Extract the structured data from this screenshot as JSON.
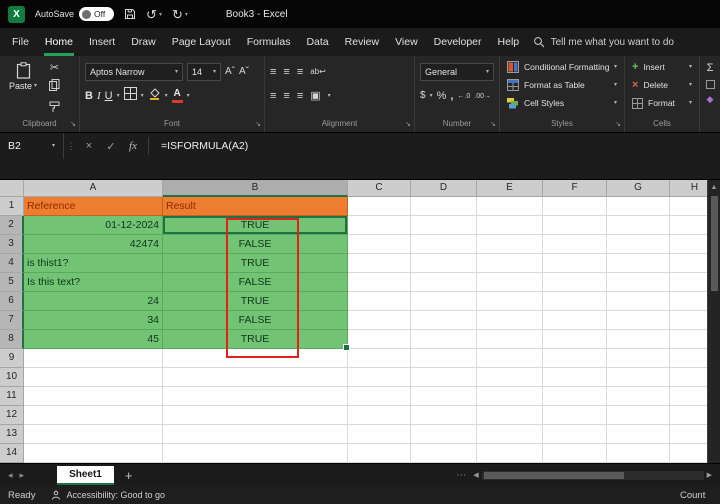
{
  "titlebar": {
    "autosave_label": "AutoSave",
    "autosave_state": "Off",
    "workbook_title": "Book3 - Excel"
  },
  "ribbon_tabs": {
    "items": [
      {
        "label": "File"
      },
      {
        "label": "Home",
        "active": true
      },
      {
        "label": "Insert"
      },
      {
        "label": "Draw"
      },
      {
        "label": "Page Layout"
      },
      {
        "label": "Formulas"
      },
      {
        "label": "Data"
      },
      {
        "label": "Review"
      },
      {
        "label": "View"
      },
      {
        "label": "Developer"
      },
      {
        "label": "Help"
      }
    ],
    "search_placeholder": "Tell me what you want to do"
  },
  "ribbon": {
    "clipboard": {
      "paste_label": "Paste",
      "group_label": "Clipboard"
    },
    "font": {
      "font_name": "Aptos Narrow",
      "font_size": "14",
      "group_label": "Font"
    },
    "alignment": {
      "group_label": "Alignment"
    },
    "number": {
      "format": "General",
      "group_label": "Number"
    },
    "styles": {
      "items": [
        "Conditional Formatting",
        "Format as Table",
        "Cell Styles"
      ],
      "group_label": "Styles"
    },
    "cells": {
      "items": [
        "Insert",
        "Delete",
        "Format"
      ],
      "group_label": "Cells"
    }
  },
  "formula_bar": {
    "name_box": "B2",
    "formula": "=ISFORMULA(A2)"
  },
  "sheet": {
    "col_headers": [
      "A",
      "B",
      "C",
      "D",
      "E",
      "F",
      "G",
      "H"
    ],
    "active_col": "B",
    "active_row": "2",
    "rows": [
      {
        "n": "1",
        "a": "Reference",
        "b": "Result"
      },
      {
        "n": "2",
        "a": "01-12-2024",
        "b": "TRUE"
      },
      {
        "n": "3",
        "a": "42474",
        "b": "FALSE"
      },
      {
        "n": "4",
        "a": "is thist1?",
        "b": "TRUE"
      },
      {
        "n": "5",
        "a": "Is this text?",
        "b": "FALSE"
      },
      {
        "n": "6",
        "a": "24",
        "b": "TRUE"
      },
      {
        "n": "7",
        "a": "34",
        "b": "FALSE"
      },
      {
        "n": "8",
        "a": "45",
        "b": "TRUE"
      },
      {
        "n": "9"
      },
      {
        "n": "10"
      },
      {
        "n": "11"
      },
      {
        "n": "12"
      },
      {
        "n": "13"
      },
      {
        "n": "14"
      }
    ],
    "colors": {
      "header_fill": "#ED7D31",
      "header_text": "#8F2B00",
      "data_fill": "#72C374",
      "annotation_red": "#E02318",
      "accent_green": "#1E7145"
    }
  },
  "sheet_tabs": {
    "active": "Sheet1"
  },
  "status_bar": {
    "mode": "Ready",
    "accessibility": "Accessibility: Good to go",
    "right": "Count"
  },
  "icons": {
    "app_logo": "X",
    "undo": "↺",
    "redo": "↻",
    "chevron": "▾",
    "cut": "✂",
    "bold": "B",
    "italic": "I",
    "underline": "U",
    "font_bigger": "Aˆ",
    "font_smaller": "Aˇ",
    "align_lines": "≡",
    "wrap_text": "ab↩",
    "merge_center": "▣",
    "accounting": "$",
    "percent": "%",
    "comma": ",",
    "increase_decimal": "←.0",
    "decrease_decimal": ".00→",
    "autosum": "Σ",
    "analyze": "◆",
    "dots": "⋮",
    "cancel": "×",
    "enter": "✓",
    "fx": "fx",
    "launcher": "↘",
    "nav_left": "◂",
    "nav_right": "▸",
    "add_sheet": "+",
    "ellipsis": "⋯",
    "scroll_left": "◀",
    "scroll_right": "▶",
    "scroll_up": "▲",
    "font_color_letter": "A"
  }
}
